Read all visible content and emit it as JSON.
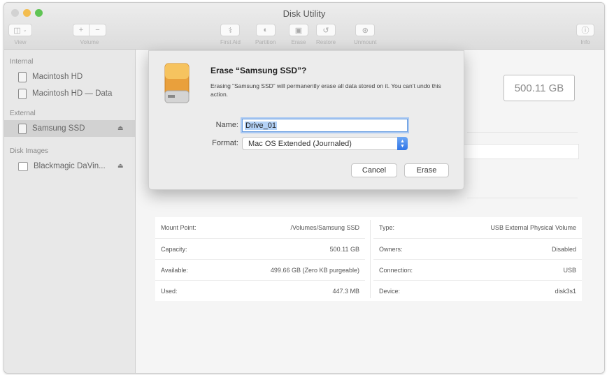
{
  "window": {
    "title": "Disk Utility"
  },
  "toolbar": {
    "view_label": "View",
    "volume_label": "Volume",
    "first_aid_label": "First Aid",
    "partition_label": "Partition",
    "erase_label": "Erase",
    "restore_label": "Restore",
    "unmount_label": "Unmount",
    "info_label": "Info"
  },
  "sidebar": {
    "internal_title": "Internal",
    "internal_items": [
      "Macintosh HD",
      "Macintosh HD — Data"
    ],
    "external_title": "External",
    "external_items": [
      "Samsung SSD"
    ],
    "disk_images_title": "Disk Images",
    "disk_image_items": [
      "Blackmagic DaVin..."
    ]
  },
  "main": {
    "capacity": "500.11 GB"
  },
  "info": {
    "left": [
      {
        "label": "Mount Point:",
        "value": "/Volumes/Samsung SSD"
      },
      {
        "label": "Capacity:",
        "value": "500.11 GB"
      },
      {
        "label": "Available:",
        "value": "499.66 GB (Zero KB purgeable)"
      },
      {
        "label": "Used:",
        "value": "447.3 MB"
      }
    ],
    "right": [
      {
        "label": "Type:",
        "value": "USB External Physical Volume"
      },
      {
        "label": "Owners:",
        "value": "Disabled"
      },
      {
        "label": "Connection:",
        "value": "USB"
      },
      {
        "label": "Device:",
        "value": "disk3s1"
      }
    ]
  },
  "dialog": {
    "title": "Erase “Samsung SSD”?",
    "message": "Erasing “Samsung SSD” will permanently erase all data stored on it. You can’t undo this action.",
    "name_label": "Name:",
    "name_value": "Drive_01",
    "format_label": "Format:",
    "format_value": "Mac OS Extended (Journaled)",
    "cancel_label": "Cancel",
    "erase_label": "Erase"
  },
  "colors": {
    "drive_orange": "#f0a93a",
    "focus_blue": "#6a9ee0",
    "select_blue": "#2f74e6"
  }
}
